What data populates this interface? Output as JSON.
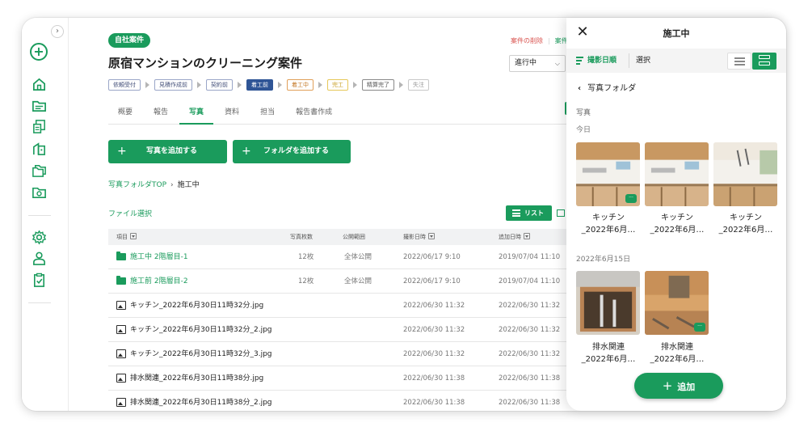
{
  "colors": {
    "accent": "#1a9b5c",
    "danger": "#d9534f",
    "step_active": "#2f5596"
  },
  "sidebar": {
    "collapse_icon": "chevron-right-icon",
    "icons": [
      "add-icon",
      "home-icon",
      "case-list-icon",
      "document-icon",
      "building-icon",
      "folder-icon",
      "photo-folder-icon",
      "settings-icon",
      "user-icon",
      "checklist-icon"
    ]
  },
  "header": {
    "badge": "自社案件",
    "title": "原宿マンションのクリーニング案件",
    "links": [
      "案件の削除",
      "案件"
    ],
    "status_value": "進行中"
  },
  "steps": [
    {
      "label": "依頼受付",
      "style": "normal"
    },
    {
      "label": "見積作成前",
      "style": "normal"
    },
    {
      "label": "契約前",
      "style": "normal"
    },
    {
      "label": "着工前",
      "style": "active"
    },
    {
      "label": "着工中",
      "style": "orange"
    },
    {
      "label": "完工",
      "style": "yellow"
    },
    {
      "label": "精算完了",
      "style": "dgray"
    },
    {
      "label": "失注",
      "style": "gray"
    }
  ],
  "tabs": [
    "概要",
    "報告",
    "写真",
    "資料",
    "担当",
    "報告書作成"
  ],
  "active_tab": "写真",
  "actions": {
    "add_photo": "写真を追加する",
    "add_folder": "フォルダを追加する"
  },
  "breadcrumb": {
    "root": "写真フォルダTOP",
    "current": "施工中"
  },
  "file_select": "ファイル選択",
  "view_toggle": {
    "list_label": "リスト"
  },
  "table": {
    "headers": {
      "name": "項目",
      "count": "写真枚数",
      "scope": "公開範囲",
      "date": "撮影日時",
      "added": "追加日時"
    },
    "rows": [
      {
        "type": "folder",
        "name": "施工中 2階層目-1",
        "count": "12枚",
        "scope": "全体公開",
        "date": "2022/06/17 9:10",
        "added": "2019/07/04 11:10"
      },
      {
        "type": "folder",
        "name": "施工前 2階層目-2",
        "count": "12枚",
        "scope": "全体公開",
        "date": "2022/06/17 9:10",
        "added": "2019/07/04 11:10"
      },
      {
        "type": "image",
        "name": "キッチン_2022年6月30日11時32分.jpg",
        "count": "",
        "scope": "",
        "date": "2022/06/30 11:32",
        "added": "2022/06/30 11:32"
      },
      {
        "type": "image",
        "name": "キッチン_2022年6月30日11時32分_2.jpg",
        "count": "",
        "scope": "",
        "date": "2022/06/30 11:32",
        "added": "2022/06/30 11:32"
      },
      {
        "type": "image",
        "name": "キッチン_2022年6月30日11時32分_3.jpg",
        "count": "",
        "scope": "",
        "date": "2022/06/30 11:32",
        "added": "2022/06/30 11:32"
      },
      {
        "type": "image",
        "name": "排水関連_2022年6月30日11時38分.jpg",
        "count": "",
        "scope": "",
        "date": "2022/06/30 11:38",
        "added": "2022/06/30 11:38"
      },
      {
        "type": "image",
        "name": "排水関連_2022年6月30日11時38分_2.jpg",
        "count": "",
        "scope": "",
        "date": "2022/06/30 11:38",
        "added": "2022/06/30 11:38"
      }
    ]
  },
  "panel": {
    "title": "施工中",
    "sort_label": "撮影日順",
    "select_label": "選択",
    "back_label": "写真フォルダ",
    "section": "写真",
    "groups": [
      {
        "date_label": "今日",
        "photos": [
          {
            "caption1": "キッチン",
            "caption2": "_2022年6月…",
            "comment": true,
            "kind": "kitchen-a"
          },
          {
            "caption1": "キッチン",
            "caption2": "_2022年6月…",
            "comment": false,
            "kind": "kitchen-b"
          },
          {
            "caption1": "キッチン",
            "caption2": "_2022年6月…",
            "comment": false,
            "kind": "kitchen-c"
          }
        ]
      },
      {
        "date_label": "2022年6月15日",
        "photos": [
          {
            "caption1": "排水関連",
            "caption2": "_2022年6月…",
            "comment": false,
            "kind": "drain-a"
          },
          {
            "caption1": "排水関連",
            "caption2": "_2022年6月…",
            "comment": true,
            "kind": "drain-b"
          }
        ]
      }
    ],
    "add_label": "追加"
  }
}
